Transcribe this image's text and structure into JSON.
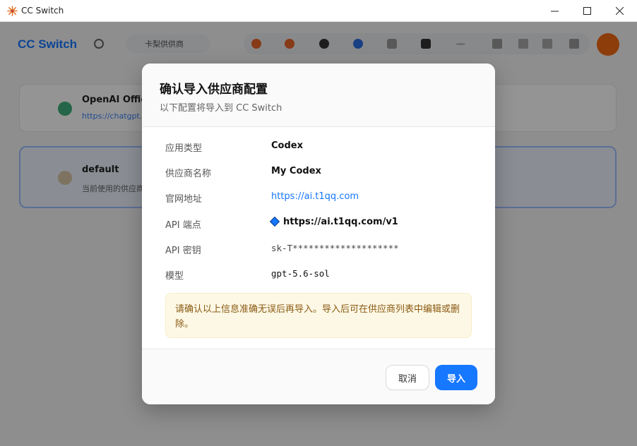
{
  "window": {
    "title": "CC Switch",
    "controls": {
      "minimize": "—",
      "maximize": "☐",
      "close": "✕"
    }
  },
  "background": {
    "brand": "CC Switch",
    "search_text": "卡梨供供商",
    "cards": [
      {
        "title": "OpenAI Official",
        "subtitle": "https://chatgpt.com"
      },
      {
        "title": "default",
        "subtitle": "当前使用的供应商"
      }
    ],
    "accent_color": "#1677ff",
    "avatar_color": "#f36a10"
  },
  "dialog": {
    "title": "确认导入供应商配置",
    "subtitle": "以下配置将导入到 CC Switch",
    "rows": [
      {
        "label": "应用类型",
        "value": "Codex"
      },
      {
        "label": "供应商名称",
        "value": "My Codex"
      },
      {
        "label": "官网地址",
        "value": "https://ai.t1qq.com"
      },
      {
        "label": "API 端点",
        "value": "https://ai.t1qq.com/v1"
      },
      {
        "label": "API 密钥",
        "value": "sk-T********************"
      },
      {
        "label": "模型",
        "value": "gpt-5.6-sol"
      }
    ],
    "warning": "请确认以上信息准确无误后再导入。导入后可在供应商列表中编辑或删除。",
    "cancel_label": "取消",
    "import_label": "导入"
  }
}
